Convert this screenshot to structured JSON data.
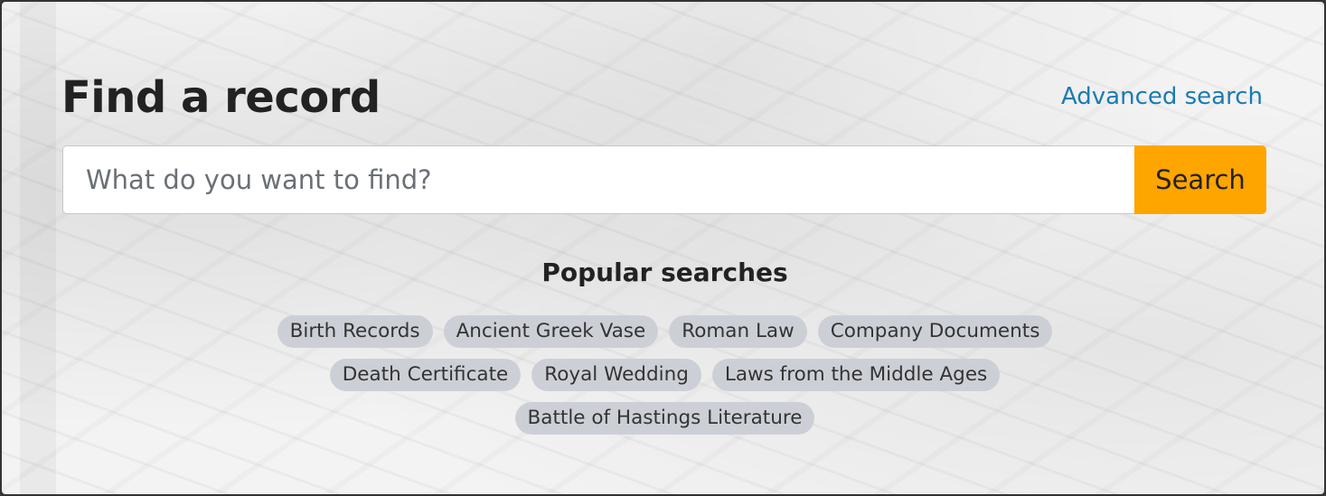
{
  "header": {
    "title": "Find a record",
    "advanced_search_label": "Advanced search"
  },
  "search": {
    "placeholder": "What do you want to find?",
    "value": "",
    "button_label": "Search"
  },
  "popular": {
    "title": "Popular searches",
    "tags": [
      "Birth Records",
      "Ancient Greek Vase",
      "Roman Law",
      "Company Documents",
      "Death Certificate",
      "Royal Wedding",
      "Laws from the Middle Ages",
      "Battle of Hastings Literature"
    ]
  },
  "colors": {
    "accent_button": "#ffa500",
    "link": "#1a7bb3",
    "tag_background": "#ccd0d6"
  }
}
